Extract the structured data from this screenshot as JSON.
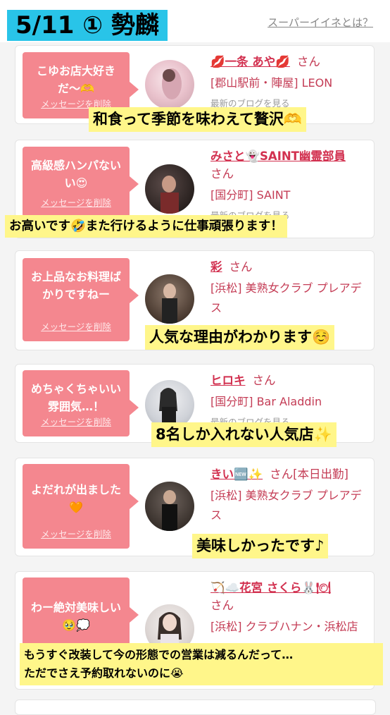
{
  "header": {
    "title": "5/11 ① 勢麟",
    "link": "スーパーイイネとは？"
  },
  "delete_label": "メッセージを削除",
  "blog_label": "最新のブログを見る",
  "colors": {
    "accent": "#f4878f",
    "name": "#d2304f",
    "highlight": "#fff68a",
    "title_bg": "#29c4e8"
  },
  "cards": [
    {
      "message": "こゆお店大好きだ〜🫶",
      "name": "💋一条 あや💋",
      "suffix": "さん",
      "tag": "",
      "shop": "[郡山駅前・陣屋] LEON",
      "overlay": [
        "和食って季節を味わえて贅沢🫶"
      ]
    },
    {
      "message": "高級感ハンパないい😍",
      "name": "みさと👻SAINT幽霊部員",
      "suffix": "さん",
      "tag": "",
      "shop": "[国分町] SAINT",
      "overlay": [
        "お高いです🤣また行けるように仕事頑張ります！"
      ]
    },
    {
      "message": "お上品なお料理ばかりですねー",
      "name": "彩",
      "suffix": "さん",
      "tag": "",
      "shop": "[浜松] 美熟女クラブ プレアデス",
      "overlay": [
        "人気な理由がわかります☺️"
      ]
    },
    {
      "message": "めちゃくちゃいい雰囲気…！",
      "name": "ヒロキ",
      "suffix": "さん",
      "tag": "",
      "shop": "[国分町] Bar Aladdin",
      "overlay": [
        "8名しか入れない人気店✨"
      ]
    },
    {
      "message": "よだれが出ました🧡",
      "name": "きい🆕✨",
      "suffix": "さん",
      "tag": "[本日出勤]",
      "shop": "[浜松] 美熟女クラブ プレアデス",
      "overlay": [
        "美味しかったです♪"
      ]
    },
    {
      "message": "わー絶対美味しい🥹💭",
      "name": "🏹☁️花宮 さくら🐰🍽",
      "suffix": "さん",
      "tag": "",
      "shop": "[浜松] クラブハナン・浜松店",
      "overlay": [
        "もうすぐ改装して今の形態での営業は減るんだって…",
        "ただでさえ予約取れないのに😭"
      ]
    }
  ]
}
